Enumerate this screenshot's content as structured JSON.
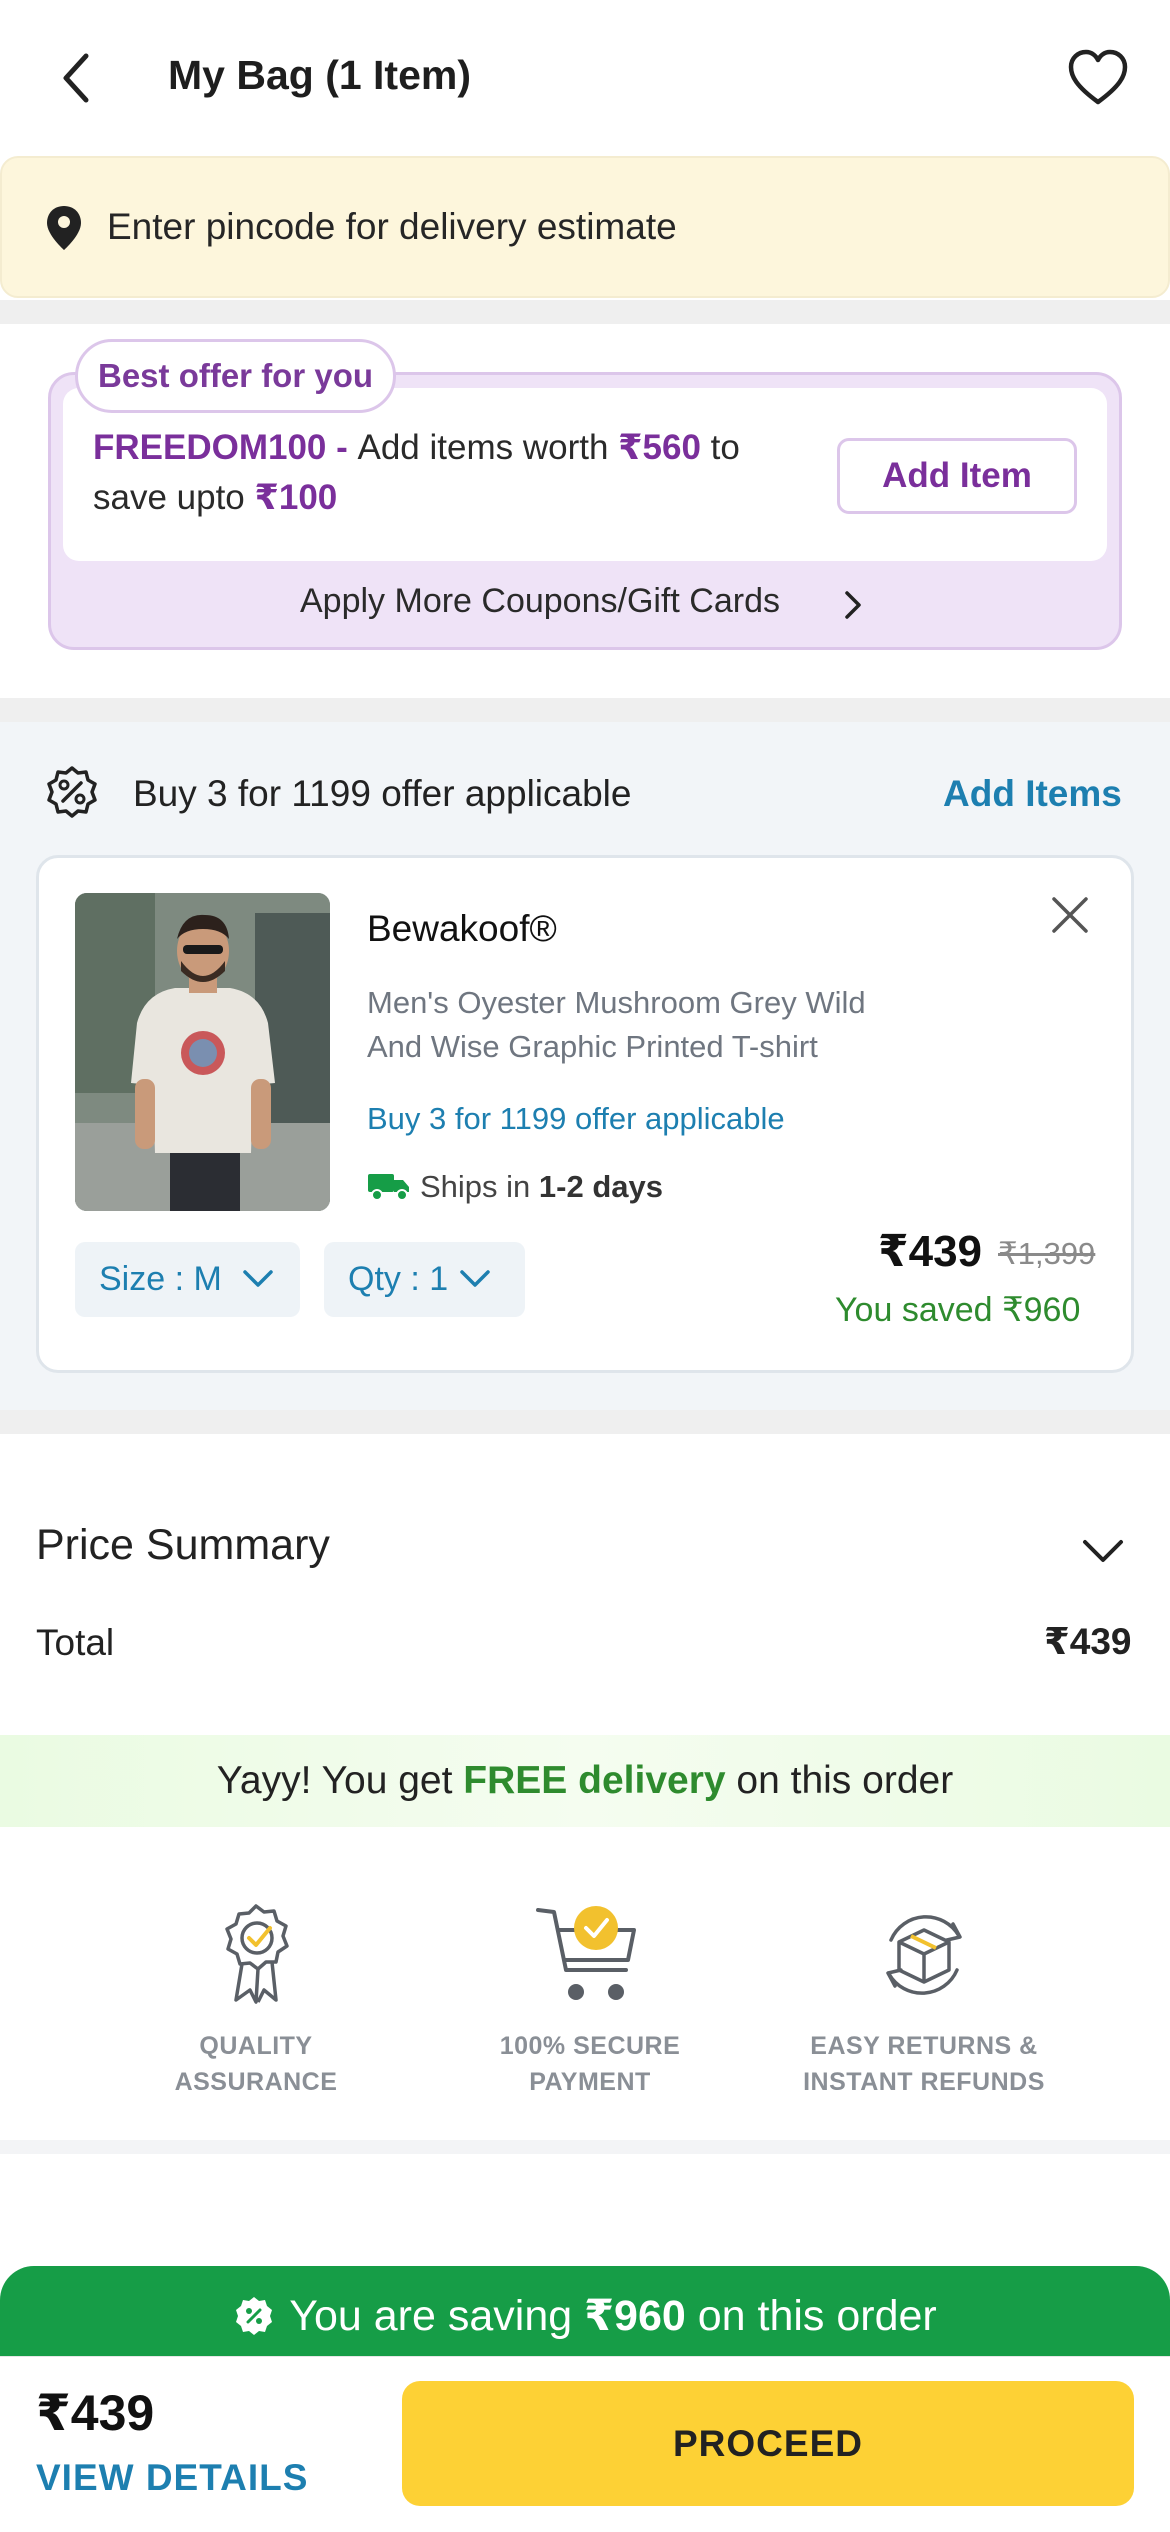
{
  "header": {
    "title": "My Bag (1 Item)",
    "back_icon": "back-chevron-icon",
    "wishlist_icon": "heart-icon"
  },
  "pincode": {
    "text": "Enter pincode for delivery estimate",
    "icon": "location-pin-icon"
  },
  "offer": {
    "badge": "Best offer for you",
    "code": "FREEDOM100 - ",
    "text_a": "Add items worth ",
    "amount": "₹560",
    "text_b": " to",
    "text_c": "save upto ",
    "discount": "₹100",
    "button_label": "Add Item",
    "more_coupons": "Apply More Coupons/Gift Cards"
  },
  "bundle_offer": {
    "text": "Buy 3 for 1199 offer applicable",
    "action": "Add Items"
  },
  "product": {
    "brand": "Bewakoof®",
    "name_line1": "Men's Oyester Mushroom Grey Wild",
    "name_line2": "And Wise Graphic Printed T-shirt",
    "offer": "Buy 3 for 1199 offer applicable",
    "ships_prefix": "Ships in ",
    "ships_days": "1-2 days",
    "size_label": "Size : M",
    "qty_label": "Qty : 1",
    "price": "₹439",
    "mrp": "₹1,399",
    "saved": "You saved ₹960"
  },
  "price_summary": {
    "title": "Price Summary",
    "total_label": "Total",
    "total_value": "₹439"
  },
  "delivery": {
    "prefix": "Yayy! You get ",
    "highlight": "FREE delivery",
    "suffix": " on this order"
  },
  "trust_badges": [
    {
      "line1": "QUALITY",
      "line2": "ASSURANCE",
      "icon": "quality-badge-icon"
    },
    {
      "line1": "100% SECURE",
      "line2": "PAYMENT",
      "icon": "secure-cart-icon"
    },
    {
      "line1": "EASY RETURNS &",
      "line2": "INSTANT REFUNDS",
      "icon": "returns-box-icon"
    }
  ],
  "saving_bar": {
    "prefix": "You are saving ",
    "amount": "₹960",
    "suffix": " on this order"
  },
  "footer": {
    "price": "₹439",
    "view_details": "VIEW DETAILS",
    "proceed": "PROCEED"
  },
  "colors": {
    "accent_blue": "#1d7fb0",
    "offer_purple": "#7a2f9b",
    "saving_green": "#169d47",
    "proceed_yellow": "#fdd135",
    "pincode_bg": "#fdf6dc"
  }
}
